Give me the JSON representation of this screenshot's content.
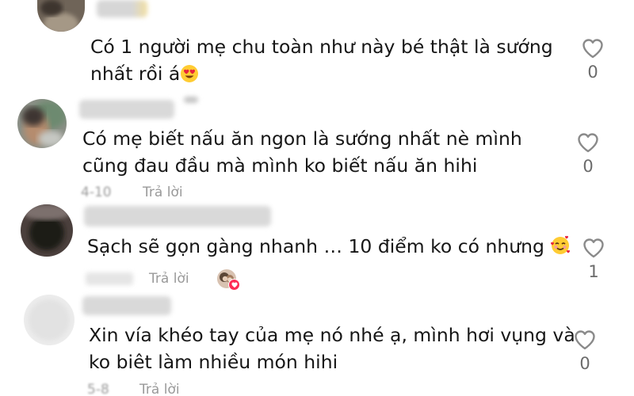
{
  "comments": [
    {
      "text_line1": "Có 1 người mẹ chu toàn như này bé thật là sướng",
      "text_line2": "nhất rồi á",
      "emoji": "heart-eyes",
      "likes": "0"
    },
    {
      "text_line1": "Có mẹ biết nấu ăn ngon là sướng nhất nè mình",
      "text_line2": "cũng đau đầu mà mình ko biết nấu ăn hihi",
      "date": "4-10",
      "reply_label": "Trả lời",
      "likes": "0"
    },
    {
      "text_line1": "Sạch sẽ gọn gàng nhanh … 10 điểm ko có nhưng",
      "emoji": "smiling-face-with-hearts",
      "reply_label": "Trả lời",
      "liked_by_creator": true,
      "likes": "1"
    },
    {
      "text_line1": "Xin vía khéo tay của mẹ nó nhé ạ, mình hơi vụng và",
      "text_line2": "ko biêt làm nhiều món hihi",
      "date": "5-8",
      "reply_label": "Trả lời",
      "likes": "0"
    }
  ],
  "colors": {
    "creator_like_heart": "#fe2c55",
    "meta_text": "#9a9a9a",
    "like_icon": "#8a8a8a"
  }
}
